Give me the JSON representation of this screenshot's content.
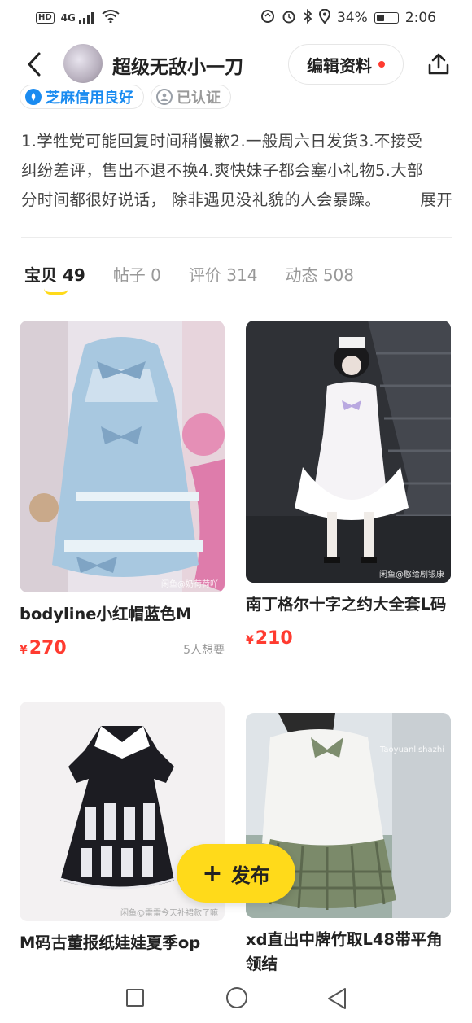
{
  "status_bar": {
    "left_badge": "HD",
    "signal": "4G",
    "battery_percent": "34%",
    "battery_level": 0.34,
    "time": "2:06"
  },
  "header": {
    "username": "超级无敌小一刀",
    "edit_label": "编辑资料"
  },
  "badges": {
    "zhima": "芝麻信用良好",
    "verified": "已认证"
  },
  "bio": {
    "lines": [
      "1.学牲党可能回复时间稍慢歉2.一般周六日发货3.不接受",
      "纠纷差评，售出不退不换4.爽快妹子都会塞小礼物5.大部",
      "分时间都很好说话， 除非遇见没礼貌的人会暴躁。"
    ],
    "expand": "展开"
  },
  "tabs": [
    {
      "label": "宝贝",
      "count": "49"
    },
    {
      "label": "帖子",
      "count": "0"
    },
    {
      "label": "评价",
      "count": "314"
    },
    {
      "label": "动态",
      "count": "508"
    }
  ],
  "items": [
    {
      "title": "bodyline小红帽蓝色M",
      "currency": "¥",
      "price": "270",
      "want": "5人想要",
      "watermark": "闲鱼@奶荷荷吖"
    },
    {
      "title": "南丁格尔十字之约大全套L码",
      "currency": "¥",
      "price": "210",
      "want": "",
      "watermark": "闲鱼@憨给剧银康"
    },
    {
      "title": "M码古董报纸娃娃夏季op",
      "currency": "",
      "price": "",
      "want": "",
      "watermark": "闲鱼@雷雷今天补裙款了嘛"
    },
    {
      "title": "xd直出中牌竹取L48带平角领结",
      "currency": "",
      "price": "",
      "want": "",
      "watermark": "Taoyuanlishazhi"
    }
  ],
  "fab": {
    "label": "发布"
  },
  "colors": {
    "accent_yellow": "#ffda1a",
    "price_red": "#ff3b30",
    "zhima_blue": "#1a8bf0"
  }
}
